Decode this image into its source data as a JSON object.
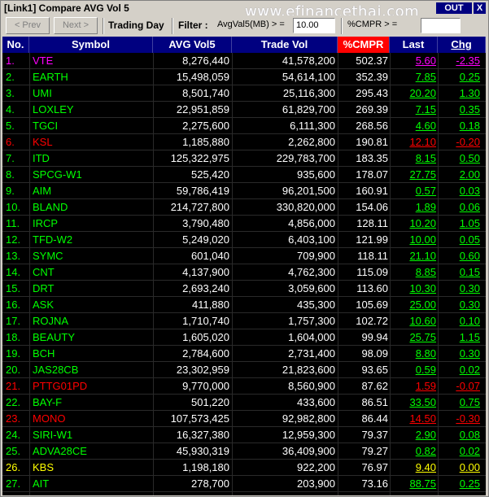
{
  "window": {
    "title": "[Link1] Compare AVG Vol 5",
    "watermark": "www.efinancethai.com",
    "out_label": "OUT",
    "close_label": "X"
  },
  "toolbar": {
    "prev_label": "< Prev",
    "next_label": "Next >",
    "trading_day_label": "Trading Day",
    "filter_label": "Filter :",
    "avg_filter_label": "AvgVal5(MB) > =",
    "avg_filter_value": "10.00",
    "cmpr_filter_label": "%CMPR > =",
    "cmpr_filter_value": ""
  },
  "columns": {
    "no": "No.",
    "symbol": "Symbol",
    "avg_vol5": "AVG Vol5",
    "trade_vol": "Trade Vol",
    "cmpr": "%CMPR",
    "last": "Last",
    "chg": "Chg"
  },
  "colors": {
    "up": "#00ff00",
    "down": "#ff0000",
    "unchanged": "#ffff00",
    "ceiling": "#ff00ff"
  },
  "rows": [
    {
      "no": "1.",
      "symbol": "VTE",
      "avg": "8,276,440",
      "vol": "41,578,200",
      "cmpr": "502.37",
      "last": "5.60",
      "chg": "-2.35",
      "status": "ceiling"
    },
    {
      "no": "2.",
      "symbol": "EARTH",
      "avg": "15,498,059",
      "vol": "54,614,100",
      "cmpr": "352.39",
      "last": "7.85",
      "chg": "0.25",
      "status": "up"
    },
    {
      "no": "3.",
      "symbol": "UMI",
      "avg": "8,501,740",
      "vol": "25,116,300",
      "cmpr": "295.43",
      "last": "20.20",
      "chg": "1.30",
      "status": "up"
    },
    {
      "no": "4.",
      "symbol": "LOXLEY",
      "avg": "22,951,859",
      "vol": "61,829,700",
      "cmpr": "269.39",
      "last": "7.15",
      "chg": "0.35",
      "status": "up"
    },
    {
      "no": "5.",
      "symbol": "TGCI",
      "avg": "2,275,600",
      "vol": "6,111,300",
      "cmpr": "268.56",
      "last": "4.60",
      "chg": "0.18",
      "status": "up"
    },
    {
      "no": "6.",
      "symbol": "KSL",
      "avg": "1,185,880",
      "vol": "2,262,800",
      "cmpr": "190.81",
      "last": "12.10",
      "chg": "-0.20",
      "status": "down"
    },
    {
      "no": "7.",
      "symbol": "ITD",
      "avg": "125,322,975",
      "vol": "229,783,700",
      "cmpr": "183.35",
      "last": "8.15",
      "chg": "0.50",
      "status": "up"
    },
    {
      "no": "8.",
      "symbol": "SPCG-W1",
      "avg": "525,420",
      "vol": "935,600",
      "cmpr": "178.07",
      "last": "27.75",
      "chg": "2.00",
      "status": "up"
    },
    {
      "no": "9.",
      "symbol": "AIM",
      "avg": "59,786,419",
      "vol": "96,201,500",
      "cmpr": "160.91",
      "last": "0.57",
      "chg": "0.03",
      "status": "up"
    },
    {
      "no": "10.",
      "symbol": "BLAND",
      "avg": "214,727,800",
      "vol": "330,820,000",
      "cmpr": "154.06",
      "last": "1.89",
      "chg": "0.06",
      "status": "up"
    },
    {
      "no": "11.",
      "symbol": "IRCP",
      "avg": "3,790,480",
      "vol": "4,856,000",
      "cmpr": "128.11",
      "last": "10.20",
      "chg": "1.05",
      "status": "up"
    },
    {
      "no": "12.",
      "symbol": "TFD-W2",
      "avg": "5,249,020",
      "vol": "6,403,100",
      "cmpr": "121.99",
      "last": "10.00",
      "chg": "0.05",
      "status": "up"
    },
    {
      "no": "13.",
      "symbol": "SYMC",
      "avg": "601,040",
      "vol": "709,900",
      "cmpr": "118.11",
      "last": "21.10",
      "chg": "0.60",
      "status": "up"
    },
    {
      "no": "14.",
      "symbol": "CNT",
      "avg": "4,137,900",
      "vol": "4,762,300",
      "cmpr": "115.09",
      "last": "8.85",
      "chg": "0.15",
      "status": "up"
    },
    {
      "no": "15.",
      "symbol": "DRT",
      "avg": "2,693,240",
      "vol": "3,059,600",
      "cmpr": "113.60",
      "last": "10.30",
      "chg": "0.30",
      "status": "up"
    },
    {
      "no": "16.",
      "symbol": "ASK",
      "avg": "411,880",
      "vol": "435,300",
      "cmpr": "105.69",
      "last": "25.00",
      "chg": "0.30",
      "status": "up"
    },
    {
      "no": "17.",
      "symbol": "ROJNA",
      "avg": "1,710,740",
      "vol": "1,757,300",
      "cmpr": "102.72",
      "last": "10.60",
      "chg": "0.10",
      "status": "up"
    },
    {
      "no": "18.",
      "symbol": "BEAUTY",
      "avg": "1,605,020",
      "vol": "1,604,000",
      "cmpr": "99.94",
      "last": "25.75",
      "chg": "1.15",
      "status": "up"
    },
    {
      "no": "19.",
      "symbol": "BCH",
      "avg": "2,784,600",
      "vol": "2,731,400",
      "cmpr": "98.09",
      "last": "8.80",
      "chg": "0.30",
      "status": "up"
    },
    {
      "no": "20.",
      "symbol": "JAS28CB",
      "avg": "23,302,959",
      "vol": "21,823,600",
      "cmpr": "93.65",
      "last": "0.59",
      "chg": "0.02",
      "status": "up"
    },
    {
      "no": "21.",
      "symbol": "PTTG01PD",
      "avg": "9,770,000",
      "vol": "8,560,900",
      "cmpr": "87.62",
      "last": "1.59",
      "chg": "-0.07",
      "status": "down"
    },
    {
      "no": "22.",
      "symbol": "BAY-F",
      "avg": "501,220",
      "vol": "433,600",
      "cmpr": "86.51",
      "last": "33.50",
      "chg": "0.75",
      "status": "up"
    },
    {
      "no": "23.",
      "symbol": "MONO",
      "avg": "107,573,425",
      "vol": "92,982,800",
      "cmpr": "86.44",
      "last": "14.50",
      "chg": "-0.30",
      "status": "down"
    },
    {
      "no": "24.",
      "symbol": "SIRI-W1",
      "avg": "16,327,380",
      "vol": "12,959,300",
      "cmpr": "79.37",
      "last": "2.90",
      "chg": "0.08",
      "status": "up"
    },
    {
      "no": "25.",
      "symbol": "ADVA28CE",
      "avg": "45,930,319",
      "vol": "36,409,900",
      "cmpr": "79.27",
      "last": "0.82",
      "chg": "0.02",
      "status": "up"
    },
    {
      "no": "26.",
      "symbol": "KBS",
      "avg": "1,198,180",
      "vol": "922,200",
      "cmpr": "76.97",
      "last": "9.40",
      "chg": "0.00",
      "status": "unchanged"
    },
    {
      "no": "27.",
      "symbol": "AIT",
      "avg": "278,700",
      "vol": "203,900",
      "cmpr": "73.16",
      "last": "88.75",
      "chg": "0.25",
      "status": "up"
    }
  ]
}
